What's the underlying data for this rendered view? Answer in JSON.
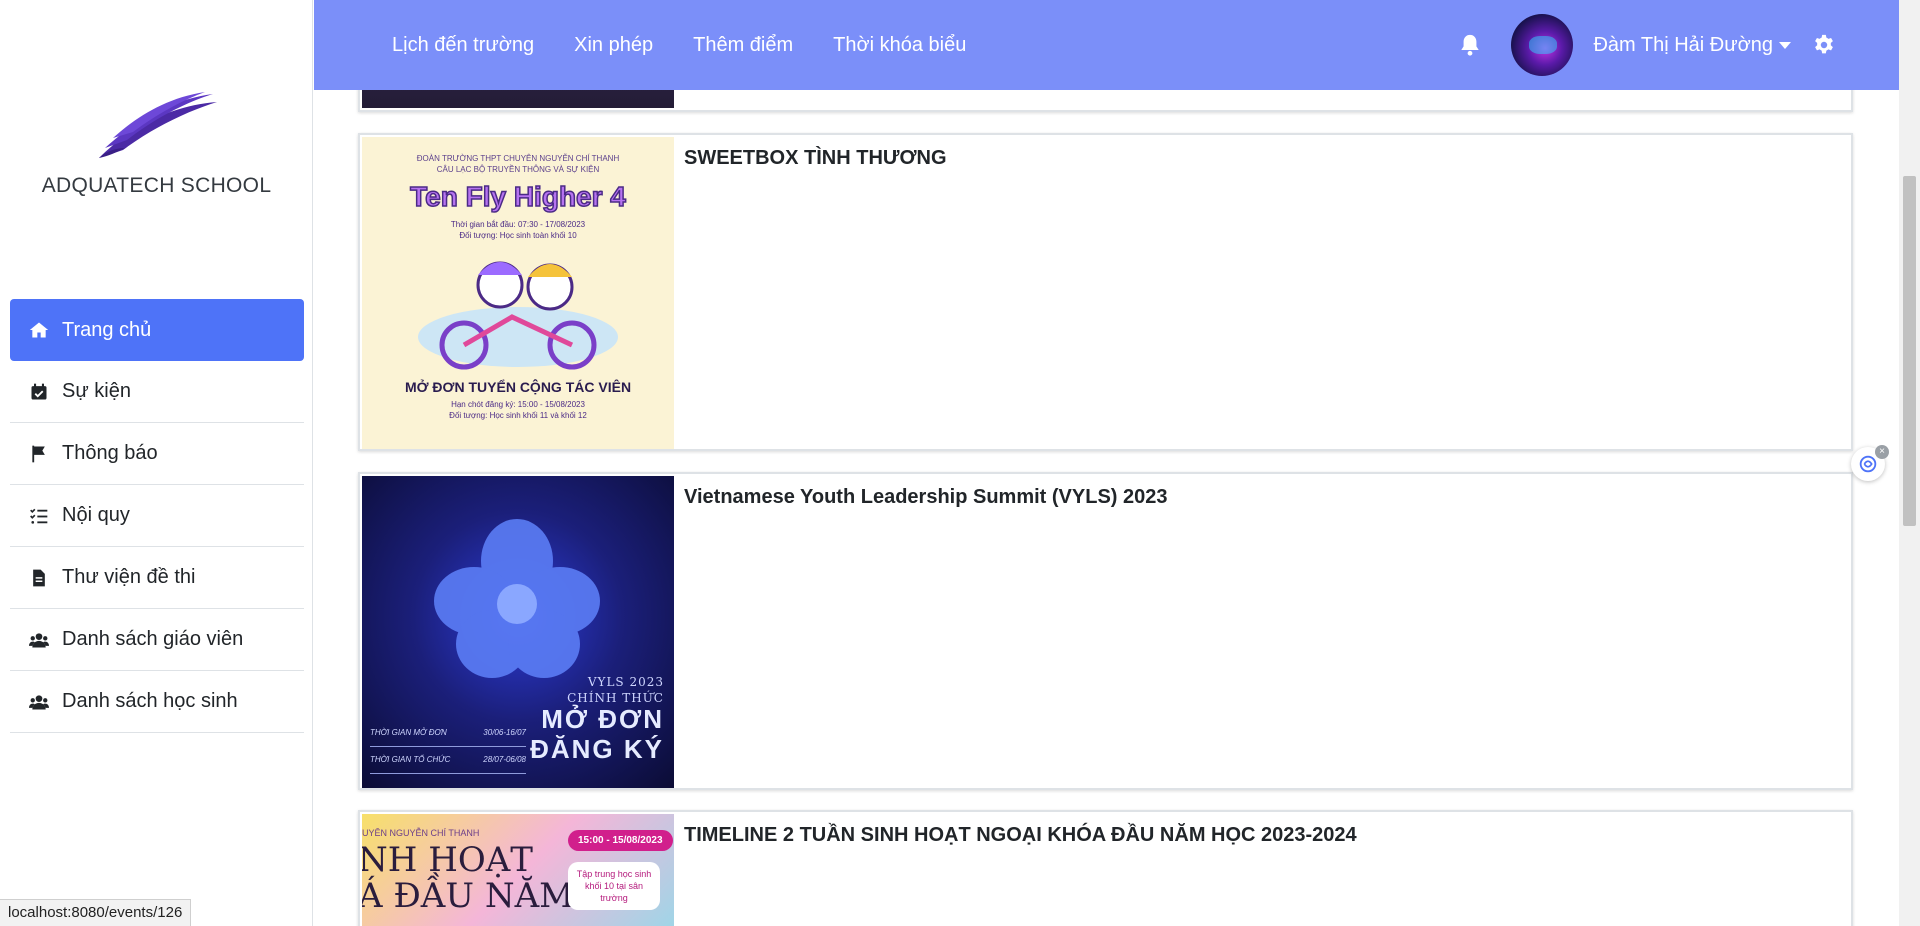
{
  "brand": {
    "name": "ADQUATECH SCHOOL"
  },
  "sidebar": {
    "items": [
      {
        "label": "Trang chủ",
        "icon": "home-icon",
        "active": true
      },
      {
        "label": "Sự kiện",
        "icon": "calendar-check-icon"
      },
      {
        "label": "Thông báo",
        "icon": "flag-icon"
      },
      {
        "label": "Nội quy",
        "icon": "checklist-icon"
      },
      {
        "label": "Thư viện đề thi",
        "icon": "file-icon"
      },
      {
        "label": "Danh sách giáo viên",
        "icon": "users-icon"
      },
      {
        "label": "Danh sách học sinh",
        "icon": "users-icon"
      }
    ]
  },
  "topbar": {
    "links": [
      "Lịch đến trường",
      "Xin phép",
      "Thêm điểm",
      "Thời khóa biểu"
    ],
    "user_name": "Đàm Thị Hải Đường",
    "background": "#7b8ff9"
  },
  "events": [
    {
      "title": "SWEETBOX TÌNH THƯƠNG",
      "poster": {
        "header": "ĐOÀN TRƯỜNG THPT CHUYÊN NGUYỄN CHÍ THANH\nCÂU LẠC BỘ TRUYỀN THÔNG VÀ SỰ KIỆN",
        "headline": "Ten Fly Higher 4",
        "info": "Thời gian bắt đầu: 07:30 - 17/08/2023\nĐối tượng: Học sinh toàn khối 10",
        "cta": "MỞ ĐƠN TUYỂN CỘNG TÁC VIÊN",
        "cta_info": "Hạn chót đăng ký: 15:00 - 15/08/2023\nĐối tượng: Học sinh khối 11 và khối 12"
      }
    },
    {
      "title": "Vietnamese Youth Leadership Summit (VYLS) 2023",
      "poster": {
        "subtitle": "VYLS 2023\nCHÍNH THỨC",
        "headline": "MỞ ĐƠN\nĐĂNG KÝ",
        "row1_label": "THỜI GIAN MỞ ĐƠN",
        "row1_value": "30/06-16/07",
        "row2_label": "THỜI GIAN TỔ CHỨC",
        "row2_value": "28/07-06/08"
      }
    },
    {
      "title": "TIMELINE 2 TUẦN SINH HOẠT NGOẠI KHÓA ĐẦU NĂM HỌC 2023-2024",
      "poster": {
        "school": "UYÊN NGUYỄN CHÍ THANH",
        "headline": "NH HOẠT\nÁ ĐẦU NĂM",
        "date_pill": "15:00 - 15/08/2023",
        "note": "Tập trung học sinh khối 10 tại sân trường"
      }
    }
  ],
  "status_url": "localhost:8080/events/126",
  "colors": {
    "accent": "#4e73f8",
    "logo": "#4b2aa5"
  }
}
